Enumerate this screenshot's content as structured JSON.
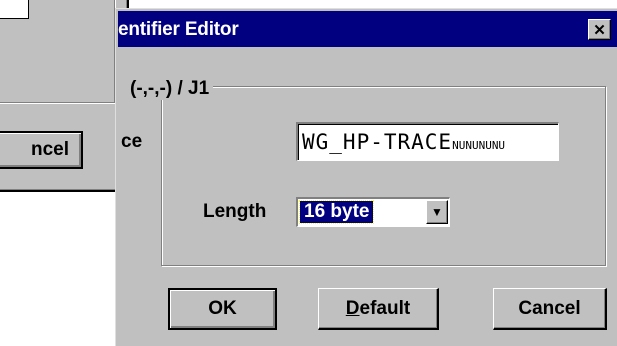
{
  "background_dialog": {
    "cancel_label": "ncel"
  },
  "dialog": {
    "title": "entifier Editor",
    "close_glyph": "✕",
    "group_label": "(-,-,-) / J1",
    "trace": {
      "label": "ce",
      "value_main": "WG_HP-TRACE",
      "value_padding": "NUNUNUNU"
    },
    "length": {
      "label": "Length",
      "selected": "16 byte",
      "arrow_glyph": "▼"
    },
    "buttons": {
      "ok": "OK",
      "default_accel": "D",
      "default_rest": "efault",
      "cancel": "Cancel"
    }
  },
  "colors": {
    "titlebar": "#000080",
    "face": "#c0c0c0",
    "selection": "#000080"
  }
}
